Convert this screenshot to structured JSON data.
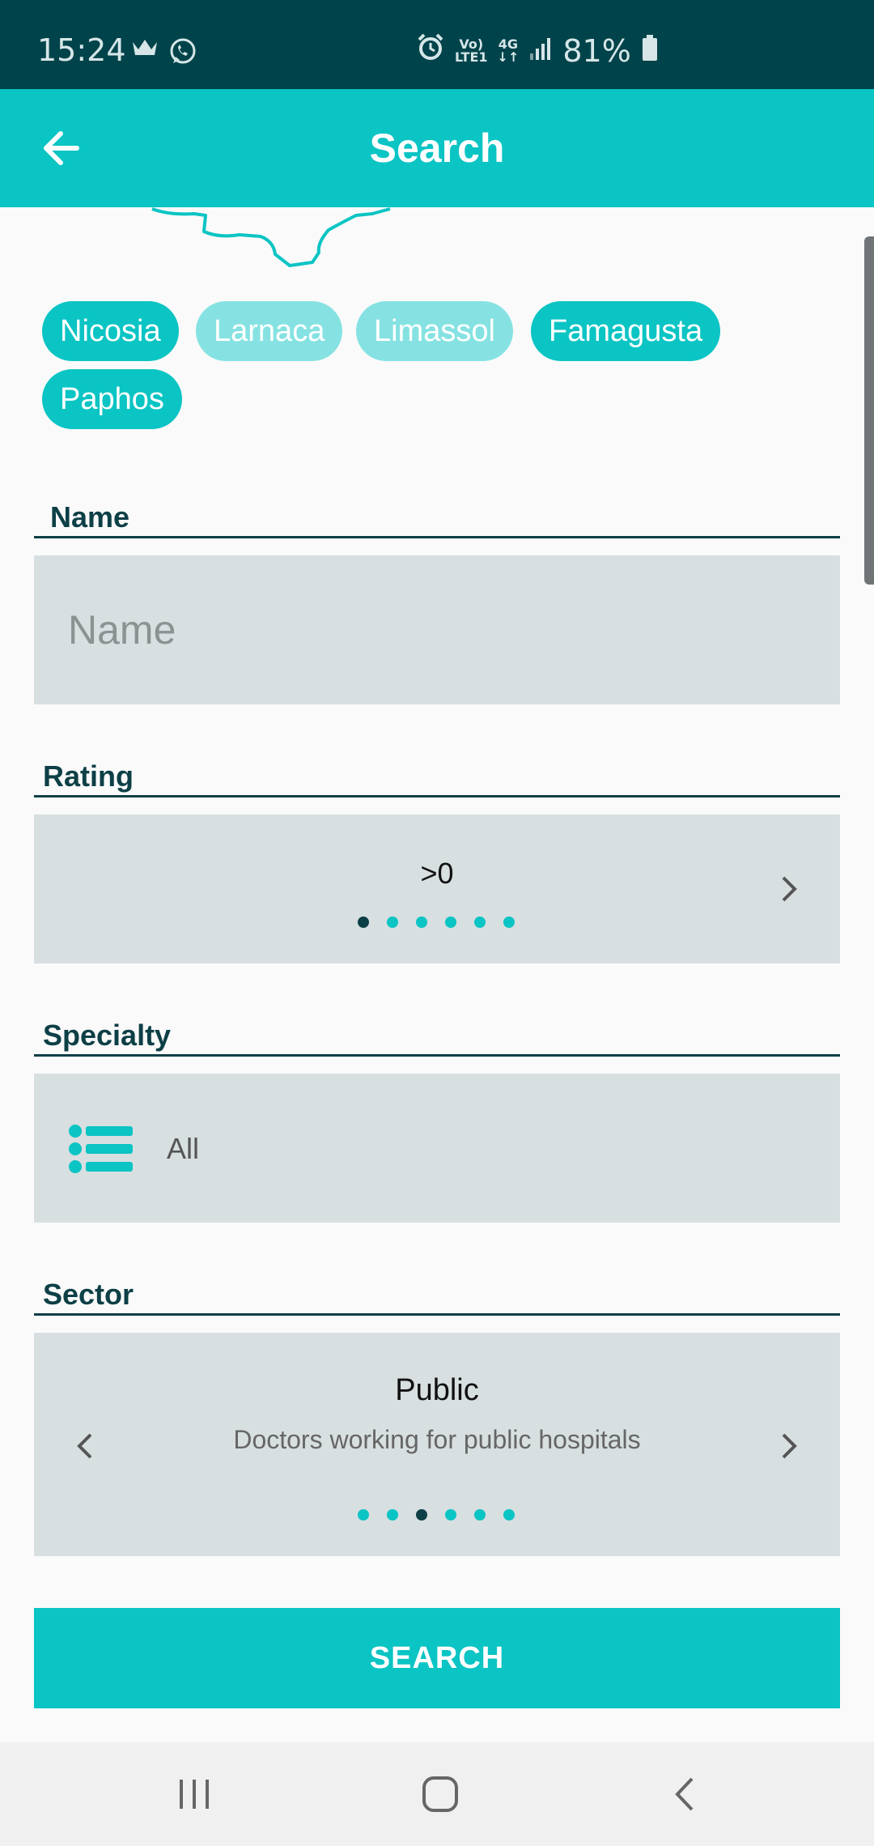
{
  "status_bar": {
    "time": "15:24",
    "battery": "81%",
    "network_label_top": "Vo)",
    "network_label_bottom": "LTE1",
    "network_type": "4G"
  },
  "app_bar": {
    "title": "Search",
    "back_icon": "arrow-left-icon"
  },
  "districts": [
    {
      "label": "Nicosia",
      "selected": true
    },
    {
      "label": "Larnaca",
      "selected": false
    },
    {
      "label": "Limassol",
      "selected": false
    },
    {
      "label": "Famagusta",
      "selected": true
    },
    {
      "label": "Paphos",
      "selected": true
    }
  ],
  "name_section": {
    "label": "Name",
    "placeholder": "Name",
    "value": ""
  },
  "rating_section": {
    "label": "Rating",
    "value": ">0",
    "page_count": 6,
    "active_page": 0
  },
  "specialty_section": {
    "label": "Specialty",
    "value": "All",
    "icon": "list-icon"
  },
  "sector_section": {
    "label": "Sector",
    "title": "Public",
    "description": "Doctors working for public hospitals",
    "page_count": 6,
    "active_page": 2
  },
  "search_button": {
    "label": "SEARCH"
  },
  "colors": {
    "accent": "#0bc4c4",
    "accent_light": "#86e2e2",
    "dark_teal": "#0d3f46",
    "status_bar": "#00434a",
    "panel": "#d7dfe1"
  }
}
